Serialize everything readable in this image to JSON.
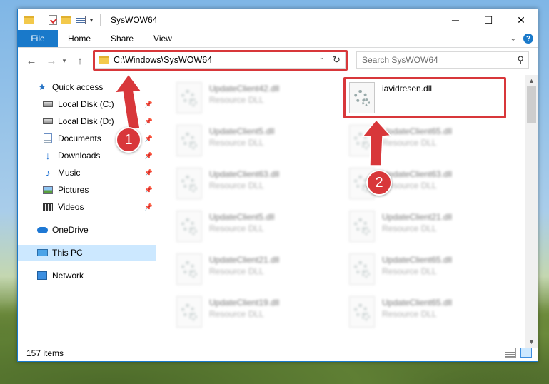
{
  "window": {
    "title": "SysWOW64"
  },
  "ribbon": {
    "tabs": [
      "File",
      "Home",
      "Share",
      "View"
    ],
    "help_label": "?"
  },
  "address": {
    "path": "C:\\Windows\\SysWOW64"
  },
  "search": {
    "placeholder": "Search SysWOW64"
  },
  "nav": {
    "items": [
      {
        "label": "Quick access",
        "icon": "star-icon"
      },
      {
        "label": "Local Disk (C:)",
        "icon": "drive-icon"
      },
      {
        "label": "Local Disk (D:)",
        "icon": "drive-icon"
      },
      {
        "label": "Documents",
        "icon": "documents-icon"
      },
      {
        "label": "Downloads",
        "icon": "download-icon"
      },
      {
        "label": "Music",
        "icon": "music-icon"
      },
      {
        "label": "Pictures",
        "icon": "pictures-icon"
      },
      {
        "label": "Videos",
        "icon": "videos-icon"
      },
      {
        "label": "OneDrive",
        "icon": "cloud-icon"
      },
      {
        "label": "This PC",
        "icon": "computer-icon"
      },
      {
        "label": "Network",
        "icon": "network-icon"
      }
    ]
  },
  "files": {
    "column1": [
      {
        "name": "UpdateClient42.dll",
        "type": "Resource DLL"
      },
      {
        "name": "UpdateClient5.dll",
        "type": "Resource DLL"
      },
      {
        "name": "UpdateClient63.dll",
        "type": "Resource DLL"
      },
      {
        "name": "UpdateClient5.dll",
        "type": "Resource DLL"
      },
      {
        "name": "UpdateClient21.dll",
        "type": "Resource DLL"
      },
      {
        "name": "UpdateClient19.dll",
        "type": "Resource DLL"
      }
    ],
    "column2": [
      {
        "name": "iavidresen.dll",
        "type": ""
      },
      {
        "name": "UpdateClient65.dll",
        "type": "Resource DLL"
      },
      {
        "name": "UpdateClient63.dll",
        "type": "Resource DLL"
      },
      {
        "name": "UpdateClient21.dll",
        "type": "Resource DLL"
      },
      {
        "name": "UpdateClient65.dll",
        "type": "Resource DLL"
      },
      {
        "name": "UpdateClient65.dll",
        "type": "Resource DLL"
      }
    ]
  },
  "status": {
    "item_count": "157 items"
  },
  "markers": {
    "one": "1",
    "two": "2"
  },
  "colors": {
    "accent": "#1979ca",
    "highlight": "#d8373a"
  }
}
